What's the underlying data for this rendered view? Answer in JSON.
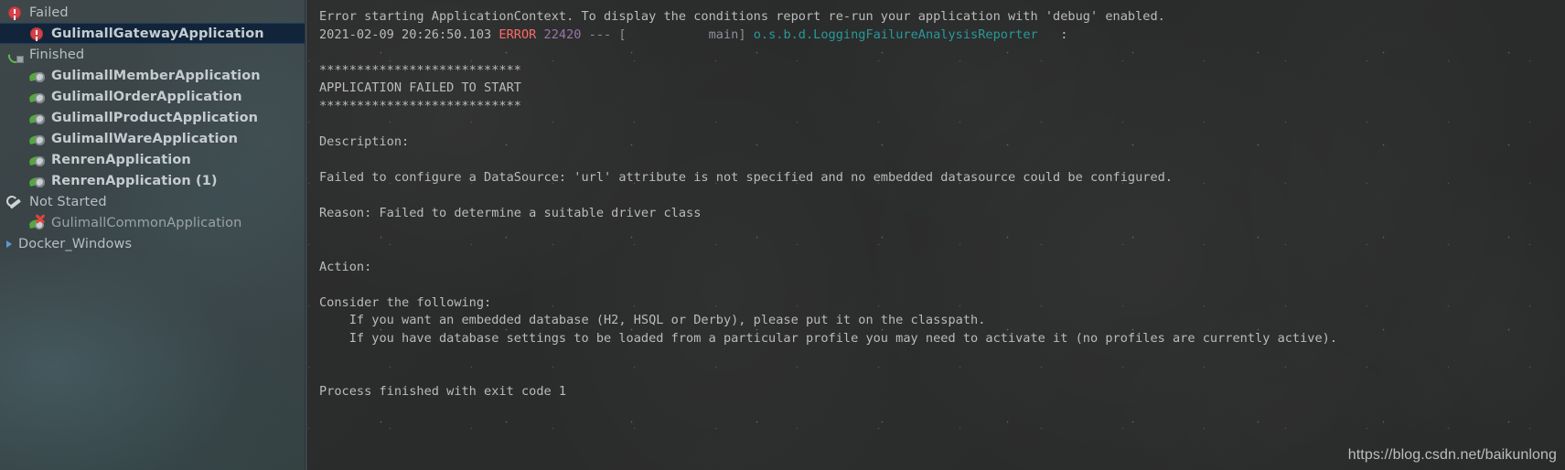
{
  "sidebar": {
    "nodes": [
      {
        "label": "Failed",
        "icon": "error-circle",
        "level": "group",
        "bold": false,
        "selected": false,
        "dim": false
      },
      {
        "label": "GulimallGatewayApplication",
        "icon": "error-circle",
        "level": "child",
        "bold": true,
        "selected": true,
        "dim": false
      },
      {
        "label": "Finished",
        "icon": "rerun",
        "level": "group",
        "bold": false,
        "selected": false,
        "dim": false
      },
      {
        "label": "GulimallMemberApplication",
        "icon": "leafclock",
        "level": "child",
        "bold": true,
        "selected": false,
        "dim": false
      },
      {
        "label": "GulimallOrderApplication",
        "icon": "leafclock",
        "level": "child",
        "bold": true,
        "selected": false,
        "dim": false
      },
      {
        "label": "GulimallProductApplication",
        "icon": "leafclock",
        "level": "child",
        "bold": true,
        "selected": false,
        "dim": false
      },
      {
        "label": "GulimallWareApplication",
        "icon": "leafclock",
        "level": "child",
        "bold": true,
        "selected": false,
        "dim": false
      },
      {
        "label": "RenrenApplication",
        "icon": "leafclock",
        "level": "child",
        "bold": true,
        "selected": false,
        "dim": false
      },
      {
        "label": "RenrenApplication (1)",
        "icon": "leafclock",
        "level": "child",
        "bold": true,
        "selected": false,
        "dim": false
      },
      {
        "label": "Not Started",
        "icon": "wrench",
        "level": "group",
        "bold": false,
        "selected": false,
        "dim": false
      },
      {
        "label": "GulimallCommonApplication",
        "icon": "leafx",
        "level": "child",
        "bold": false,
        "selected": false,
        "dim": true
      },
      {
        "label": "Docker_Windows",
        "icon": "tri-right",
        "level": "root",
        "bold": false,
        "selected": false,
        "dim": false
      }
    ],
    "selection_color": "#12243a"
  },
  "console": {
    "line1_text": "Error starting ApplicationContext. To display the conditions report re-run your application with 'debug' enabled.",
    "log_line": {
      "timestamp": "2021-02-09 20:26:50.103",
      "level": "ERROR",
      "pid": "22420",
      "separator": "---",
      "thread": "[           main]",
      "logger": "o.s.b.d.LoggingFailureAnalysisReporter",
      "colon": ":"
    },
    "banner_top": "***************************",
    "banner_title": "APPLICATION FAILED TO START",
    "banner_bottom": "***************************",
    "description_label": "Description:",
    "description_text": "Failed to configure a DataSource: 'url' attribute is not specified and no embedded datasource could be configured.",
    "reason_text": "Reason: Failed to determine a suitable driver class",
    "action_label": "Action:",
    "consider_label": "Consider the following:",
    "bullet1": "\tIf you want an embedded database (H2, HSQL or Derby), please put it on the classpath.",
    "bullet2": "\tIf you have database settings to be loaded from a particular profile you may need to activate it (no profiles are currently active).",
    "process_line": "Process finished with exit code 1",
    "colors": {
      "error": "#ff6b68",
      "pid": "#9876aa",
      "logger": "#299999",
      "default_text": "#a9b7c6"
    }
  },
  "watermark": {
    "text": "https://blog.csdn.net/baikunlong"
  }
}
